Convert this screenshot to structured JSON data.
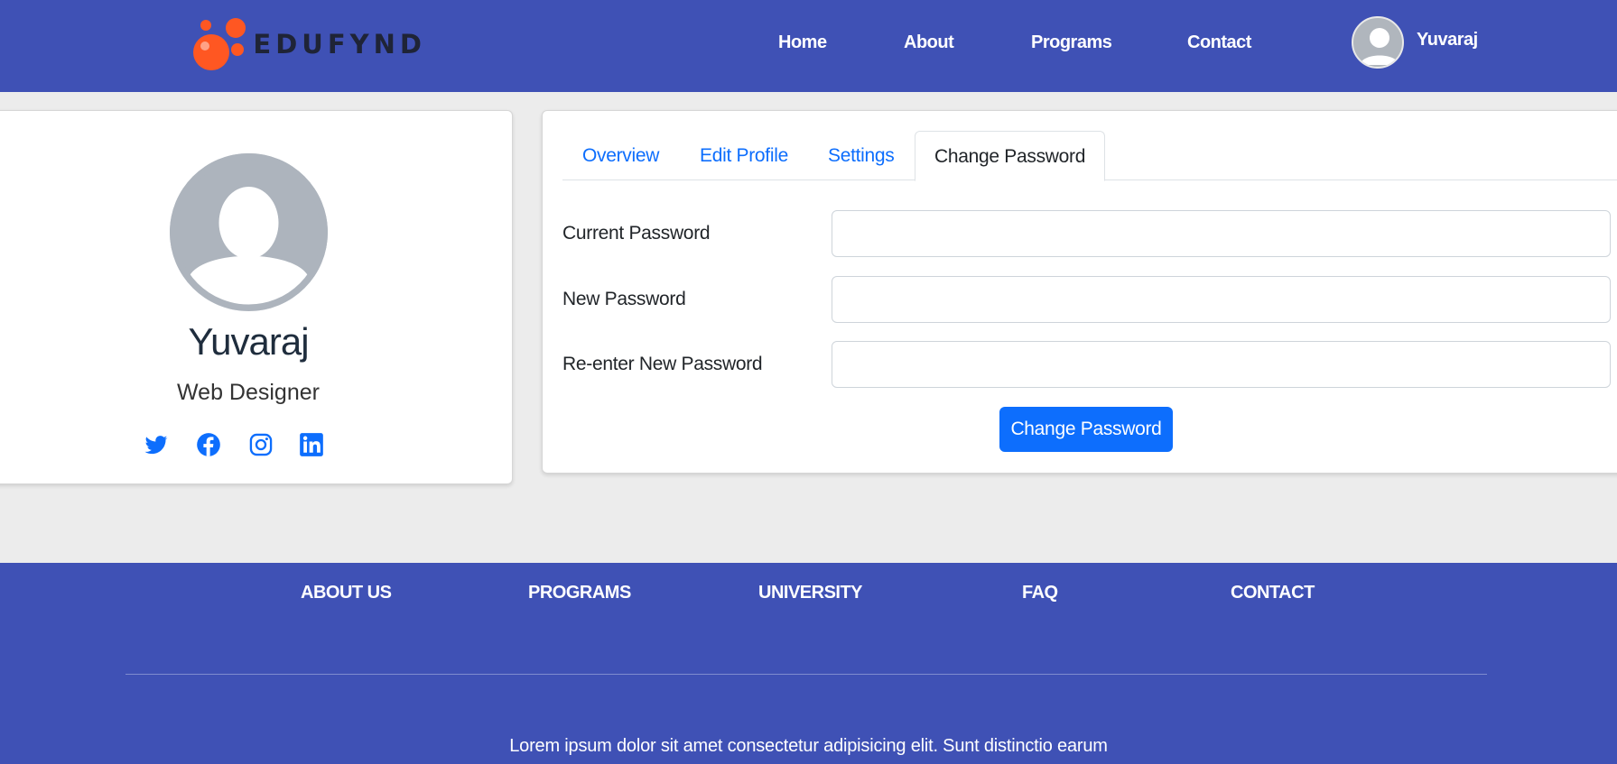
{
  "header": {
    "brand": "EDUFYND",
    "nav": [
      "Home",
      "About",
      "Programs",
      "Contact"
    ],
    "user_name": "Yuvaraj"
  },
  "profile": {
    "name": "Yuvaraj",
    "role": "Web Designer",
    "socials": [
      "twitter-icon",
      "facebook-icon",
      "instagram-icon",
      "linkedin-icon"
    ]
  },
  "tabs": [
    "Overview",
    "Edit Profile",
    "Settings",
    "Change Password"
  ],
  "active_tab": "Change Password",
  "form": {
    "current_password": {
      "label": "Current Password",
      "value": ""
    },
    "new_password": {
      "label": "New Password",
      "value": ""
    },
    "renew_password": {
      "label": "Re-enter New Password",
      "value": ""
    },
    "submit_label": "Change Password"
  },
  "footer": {
    "links": [
      "ABOUT US",
      "PROGRAMS",
      "UNIVERSITY",
      "FAQ",
      "CONTACT"
    ],
    "text": "Lorem ipsum dolor sit amet consectetur adipisicing elit. Sunt distinctio earum"
  },
  "colors": {
    "primary": "#3f51b5",
    "accent": "#ff5722",
    "button": "#0d6efd",
    "link": "#0d6efd"
  }
}
